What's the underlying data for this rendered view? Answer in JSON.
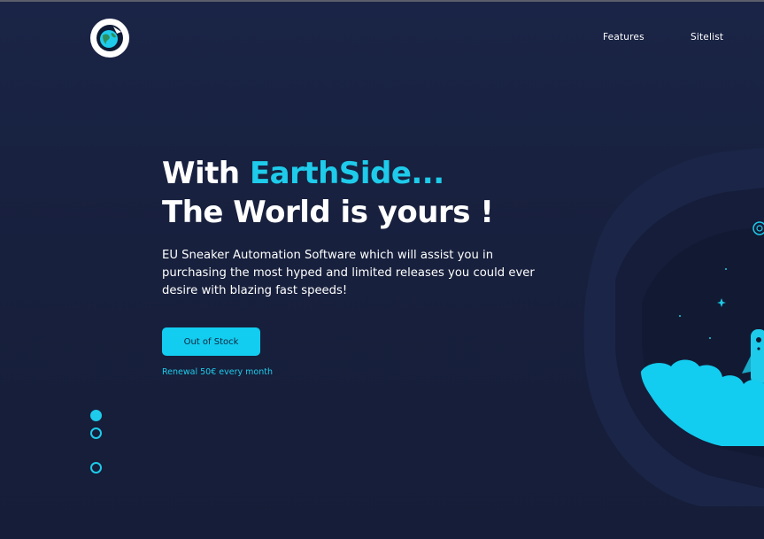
{
  "header": {
    "logo_icon": "earth-globe-icon",
    "nav": [
      {
        "label": "Features"
      },
      {
        "label": "Sitelist"
      }
    ]
  },
  "hero": {
    "title_prefix": "With ",
    "title_brand": "EarthSide...",
    "title_line2": "The World is yours !",
    "description": "EU Sneaker Automation Software which will assist you in purchasing the most hyped and limited releases you could ever desire with blazing fast speeds!",
    "cta_label": "Out of Stock",
    "renewal_text": "Renewal 50€ every month"
  },
  "slider": {
    "active_index": 0,
    "count": 3
  },
  "colors": {
    "background": "#17203d",
    "accent": "#1ecbea",
    "text": "#ffffff"
  },
  "illustration": {
    "icon": "rocket-in-clouds-illustration"
  }
}
